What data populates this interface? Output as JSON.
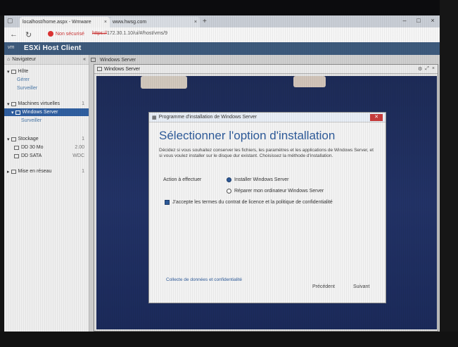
{
  "browser": {
    "tabs": [
      {
        "label": "localhost/home.aspx - Wmware"
      },
      {
        "label": "www.hwsg.com"
      }
    ],
    "security_label": "Non sécurisé",
    "url_scheme": "https://",
    "url_rest": "172.30.1.10/ui/#/host/vms/9"
  },
  "esxi": {
    "logo": "vm",
    "title": "ESXi Host Client"
  },
  "navigator": {
    "title": "Navigateur",
    "items": [
      {
        "label": "Hôte"
      },
      {
        "label": "Gérer"
      },
      {
        "label": "Surveiller"
      },
      {
        "label": "Machines virtuelles",
        "badge": "1"
      },
      {
        "label": "Windows Server"
      },
      {
        "label": "Surveiller"
      },
      {
        "label": "Stockage",
        "badge": "1"
      },
      {
        "label": "DD 30 Mo",
        "badge": "2.00"
      },
      {
        "label": "DD SATA",
        "badge": "WDC"
      },
      {
        "label": "Mise en réseau",
        "badge": "1"
      }
    ]
  },
  "console": {
    "tab_label": "Windows Server",
    "window_title": "Windows Server"
  },
  "setup": {
    "window_title": "Programme d'installation de Windows Server",
    "heading": "Sélectionner l'option d'installation",
    "description": "Décidez si vous souhaitez conserver les fichiers, les paramètres et les applications de Windows Server, et si vous voulez installer sur le disque dur existant. Choisissez la méthode d'installation.",
    "label": "Action à effectuer",
    "options": [
      {
        "label": "Installer Windows Server"
      },
      {
        "label": "Réparer mon ordinateur Windows Server"
      }
    ],
    "checkbox_label": "J'accepte les termes du contrat de licence et la politique de confidentialité",
    "link_label": "Collecte de données et confidentialité",
    "back_label": "Précédent",
    "next_label": "Suivant"
  }
}
